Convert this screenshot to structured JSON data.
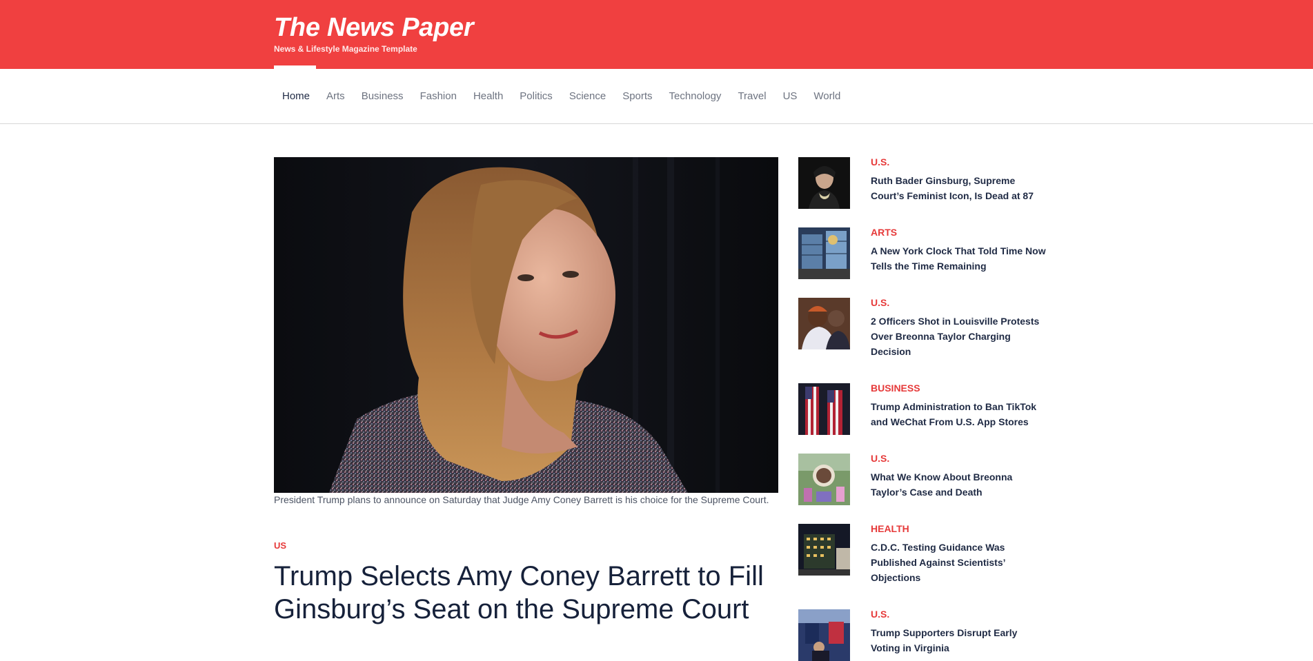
{
  "header": {
    "title": "The News Paper",
    "tagline": "News & Lifestyle Magazine Template",
    "accent_color": "#f04040"
  },
  "nav": {
    "items": [
      "Home",
      "Arts",
      "Business",
      "Fashion",
      "Health",
      "Politics",
      "Science",
      "Sports",
      "Technology",
      "Travel",
      "US",
      "World"
    ],
    "active": "Home"
  },
  "main": {
    "caption": "President Trump plans to announce on Saturday that Judge Amy Coney Barrett is his choice for the Supreme Court.",
    "category": "US",
    "title": "Trump Selects Amy Coney Barrett to Fill Ginsburg’s Seat on the Supreme Court"
  },
  "sidebar": {
    "items": [
      {
        "category": "U.S.",
        "title": "Ruth Bader Ginsburg, Supreme Court’s Feminist Icon, Is Dead at 87"
      },
      {
        "category": "ARTS",
        "title": "A New York Clock That Told Time Now Tells the Time Remaining"
      },
      {
        "category": "U.S.",
        "title": "2 Officers Shot in Louisville Protests Over Breonna Taylor Charging Decision"
      },
      {
        "category": "BUSINESS",
        "title": "Trump Administration to Ban TikTok and WeChat From U.S. App Stores"
      },
      {
        "category": "U.S.",
        "title": "What We Know About Breonna Taylor’s Case and Death"
      },
      {
        "category": "HEALTH",
        "title": "C.D.C. Testing Guidance Was Published Against Scientists’ Objections"
      },
      {
        "category": "U.S.",
        "title": "Trump Supporters Disrupt Early Voting in Virginia"
      }
    ]
  }
}
